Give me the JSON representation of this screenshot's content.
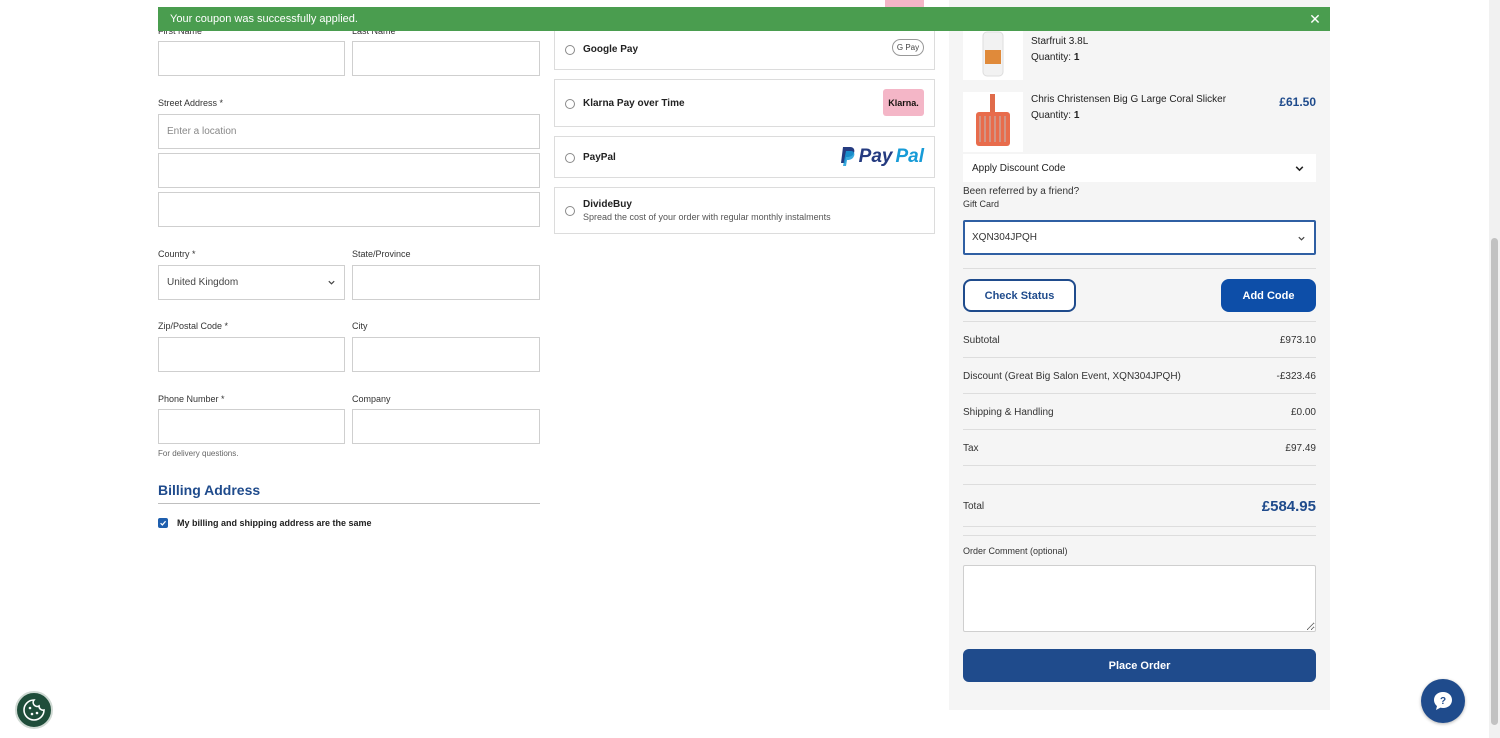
{
  "notice": {
    "message": "Your coupon was successfully applied."
  },
  "shipping_form": {
    "first_name_label": "First Name",
    "last_name_label": "Last Name",
    "street_label": "Street Address *",
    "street_placeholder": "Enter a location",
    "country_label": "Country *",
    "country_value": "United Kingdom",
    "state_label": "State/Province",
    "zip_label": "Zip/Postal Code *",
    "city_label": "City",
    "phone_label": "Phone Number *",
    "company_label": "Company",
    "phone_help": "For delivery questions."
  },
  "billing": {
    "title": "Billing Address",
    "same_address_label": "My billing and shipping address are the same",
    "same_address_checked": true
  },
  "payments": [
    {
      "label": "Google Pay",
      "badge": "G Pay"
    },
    {
      "label": "Klarna Pay over Time",
      "badge": "Klarna."
    },
    {
      "label": "PayPal",
      "badge_a": "Pay",
      "badge_b": "Pal"
    },
    {
      "label": "DivideBuy",
      "sub": "Spread the cost of your order with regular monthly instalments"
    }
  ],
  "summary": {
    "items": [
      {
        "name": "Starfruit 3.8L",
        "qty_label": "Quantity:",
        "qty": "1"
      },
      {
        "name": "Chris Christensen Big G Large Coral Slicker",
        "qty_label": "Quantity:",
        "qty": "1",
        "price": "£61.50"
      }
    ],
    "discount_toggle": "Apply Discount Code",
    "referred": "Been referred by a friend?",
    "gift_label": "Gift Card",
    "gift_value": "XQN304JPQH",
    "check_status": "Check Status",
    "add_code": "Add Code",
    "totals": [
      {
        "label": "Subtotal",
        "value": "£973.10"
      },
      {
        "label": "Discount (Great Big Salon Event, XQN304JPQH)",
        "value": "-£323.46"
      },
      {
        "label": "Shipping & Handling",
        "value": "£0.00"
      },
      {
        "label": "Tax",
        "value": "£97.49"
      }
    ],
    "total_label": "Total",
    "total_value": "£584.95",
    "comment_label": "Order Comment (optional)",
    "place_order": "Place Order"
  },
  "colors": {
    "success": "#4a9d4f",
    "brand": "#1f4b8c",
    "button": "#0d4ea8",
    "klarna": "#f4b6c7"
  }
}
